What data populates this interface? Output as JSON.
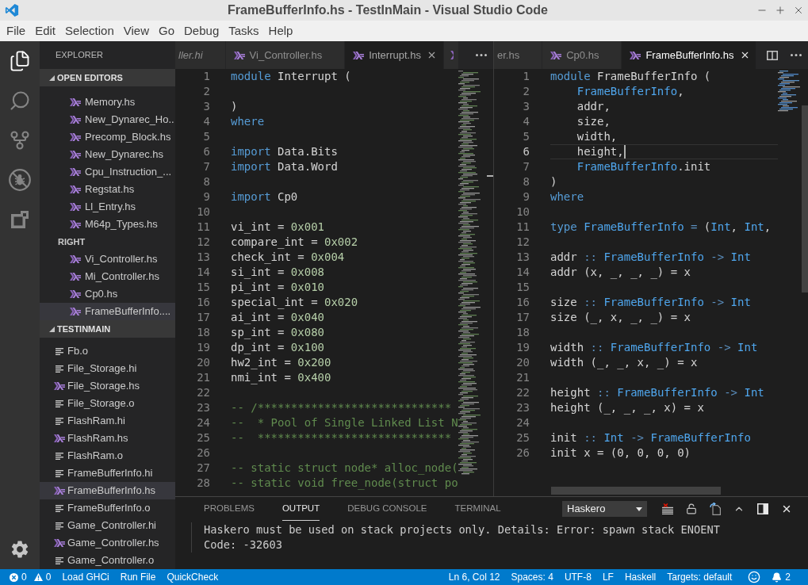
{
  "window": {
    "title": "FrameBufferInfo.hs - TestInMain - Visual Studio Code"
  },
  "menu": [
    "File",
    "Edit",
    "Selection",
    "View",
    "Go",
    "Debug",
    "Tasks",
    "Help"
  ],
  "activity_bar": [
    {
      "selected": true
    },
    {
      "selected": false
    },
    {
      "selected": false
    },
    {
      "selected": false
    },
    {
      "selected": false
    }
  ],
  "sidebar": {
    "title": "EXPLORER",
    "sections": [
      {
        "title": "OPEN EDITORS",
        "expanded": true,
        "groups": [
          {
            "items": [
              {
                "label": "Memory.hs",
                "kind": "haskell",
                "selected": false
              },
              {
                "label": "New_Dynarec_Ho..",
                "kind": "haskell",
                "selected": false
              },
              {
                "label": "Precomp_Block.hs",
                "kind": "haskell",
                "selected": false
              },
              {
                "label": "New_Dynarec.hs",
                "kind": "haskell",
                "selected": false
              },
              {
                "label": "Cpu_Instruction_...",
                "kind": "haskell",
                "selected": false
              },
              {
                "label": "Regstat.hs",
                "kind": "haskell",
                "selected": false
              },
              {
                "label": "Ll_Entry.hs",
                "kind": "haskell",
                "selected": false
              },
              {
                "label": "M64p_Types.hs",
                "kind": "haskell",
                "selected": false
              }
            ]
          },
          {
            "title": "RIGHT",
            "items": [
              {
                "label": "Vi_Controller.hs",
                "kind": "haskell",
                "selected": false
              },
              {
                "label": "Mi_Controller.hs",
                "kind": "haskell",
                "selected": false
              },
              {
                "label": "Cp0.hs",
                "kind": "haskell",
                "selected": false
              },
              {
                "label": "FrameBufferInfo....",
                "kind": "haskell",
                "selected": true
              }
            ]
          }
        ]
      },
      {
        "title": "TESTINMAIN",
        "expanded": true,
        "items": [
          {
            "label": "Fb.o",
            "kind": "text",
            "selected": false
          },
          {
            "label": "File_Storage.hi",
            "kind": "text",
            "selected": false
          },
          {
            "label": "File_Storage.hs",
            "kind": "haskell",
            "selected": false
          },
          {
            "label": "File_Storage.o",
            "kind": "text",
            "selected": false
          },
          {
            "label": "FlashRam.hi",
            "kind": "text",
            "selected": false
          },
          {
            "label": "FlashRam.hs",
            "kind": "haskell",
            "selected": false
          },
          {
            "label": "FlashRam.o",
            "kind": "text",
            "selected": false
          },
          {
            "label": "FrameBufferInfo.hi",
            "kind": "text",
            "selected": false
          },
          {
            "label": "FrameBufferInfo.hs",
            "kind": "haskell",
            "selected": true
          },
          {
            "label": "FrameBufferInfo.o",
            "kind": "text",
            "selected": false
          },
          {
            "label": "Game_Controller.hi",
            "kind": "text",
            "selected": false
          },
          {
            "label": "Game_Controller.hs",
            "kind": "haskell",
            "selected": false
          },
          {
            "label": "Game_Controller.o",
            "kind": "text",
            "selected": false
          }
        ]
      }
    ]
  },
  "editor_groups": [
    {
      "focused": false,
      "tabs": [
        {
          "label": "ller.hi",
          "preview": true,
          "selected": false
        },
        {
          "label": "Vi_Controller.hs",
          "kind": "haskell",
          "preview": false,
          "selected": false
        },
        {
          "label": "Interrupt.hs",
          "kind": "haskell",
          "preview": false,
          "selected": true
        },
        {
          "kind": "haskell",
          "selected": false
        }
      ],
      "lines": [
        {
          "number": "1",
          "code": [
            {
              "kind": "keyword",
              "text": "module"
            },
            {
              "kind": "plain",
              "text": " Interrupt ("
            }
          ]
        },
        {
          "number": "2"
        },
        {
          "number": "3",
          "code": [
            {
              "kind": "plain",
              "text": ")"
            }
          ]
        },
        {
          "number": "4",
          "code": [
            {
              "kind": "keyword",
              "text": "where"
            }
          ]
        },
        {
          "number": "5"
        },
        {
          "number": "6",
          "code": [
            {
              "kind": "keyword",
              "text": "import"
            },
            {
              "kind": "plain",
              "text": " Data.Bits"
            }
          ]
        },
        {
          "number": "7",
          "code": [
            {
              "kind": "keyword",
              "text": "import"
            },
            {
              "kind": "plain",
              "text": " Data.Word"
            }
          ]
        },
        {
          "number": "8"
        },
        {
          "number": "9",
          "code": [
            {
              "kind": "keyword",
              "text": "import"
            },
            {
              "kind": "plain",
              "text": " Cp0"
            }
          ]
        },
        {
          "number": "10"
        },
        {
          "number": "11",
          "code": [
            {
              "kind": "plain",
              "text": "vi_int = "
            },
            {
              "kind": "number",
              "text": "0x001"
            }
          ]
        },
        {
          "number": "12",
          "code": [
            {
              "kind": "plain",
              "text": "compare_int = "
            },
            {
              "kind": "number",
              "text": "0x002"
            }
          ]
        },
        {
          "number": "13",
          "code": [
            {
              "kind": "plain",
              "text": "check_int = "
            },
            {
              "kind": "number",
              "text": "0x004"
            }
          ]
        },
        {
          "number": "14",
          "code": [
            {
              "kind": "plain",
              "text": "si_int = "
            },
            {
              "kind": "number",
              "text": "0x008"
            }
          ]
        },
        {
          "number": "15",
          "code": [
            {
              "kind": "plain",
              "text": "pi_int = "
            },
            {
              "kind": "number",
              "text": "0x010"
            }
          ]
        },
        {
          "number": "16",
          "code": [
            {
              "kind": "plain",
              "text": "special_int = "
            },
            {
              "kind": "number",
              "text": "0x020"
            }
          ]
        },
        {
          "number": "17",
          "code": [
            {
              "kind": "plain",
              "text": "ai_int = "
            },
            {
              "kind": "number",
              "text": "0x040"
            }
          ]
        },
        {
          "number": "18",
          "code": [
            {
              "kind": "plain",
              "text": "sp_int = "
            },
            {
              "kind": "number",
              "text": "0x080"
            }
          ]
        },
        {
          "number": "19",
          "code": [
            {
              "kind": "plain",
              "text": "dp_int = "
            },
            {
              "kind": "number",
              "text": "0x100"
            }
          ]
        },
        {
          "number": "20",
          "code": [
            {
              "kind": "plain",
              "text": "hw2_int = "
            },
            {
              "kind": "number",
              "text": "0x200"
            }
          ]
        },
        {
          "number": "21",
          "code": [
            {
              "kind": "plain",
              "text": "nmi_int = "
            },
            {
              "kind": "number",
              "text": "0x400"
            }
          ]
        },
        {
          "number": "22"
        },
        {
          "number": "23",
          "code": [
            {
              "kind": "comment",
              "text": "-- /*****************************"
            }
          ]
        },
        {
          "number": "24",
          "code": [
            {
              "kind": "comment",
              "text": "--  * Pool of Single Linked List N"
            }
          ]
        },
        {
          "number": "25",
          "code": [
            {
              "kind": "comment",
              "text": "--  *****************************"
            }
          ]
        },
        {
          "number": "26"
        },
        {
          "number": "27",
          "code": [
            {
              "kind": "comment",
              "text": "-- static struct node* alloc_node("
            }
          ]
        },
        {
          "number": "28",
          "code": [
            {
              "kind": "comment",
              "text": "-- static void free_node(struct po"
            }
          ]
        }
      ]
    },
    {
      "focused": true,
      "tabs": [
        {
          "label": "er.hs",
          "preview": false,
          "selected": false
        },
        {
          "label": "Cp0.hs",
          "kind": "haskell",
          "preview": false,
          "selected": false
        },
        {
          "label": "FrameBufferInfo.hs",
          "kind": "haskell",
          "preview": false,
          "selected": true
        }
      ],
      "lines": [
        {
          "number": "1",
          "current": false,
          "code": [
            {
              "kind": "keyword",
              "text": "module"
            },
            {
              "kind": "plain",
              "text": " FrameBufferInfo ("
            }
          ]
        },
        {
          "number": "2",
          "current": false,
          "code": [
            {
              "kind": "type",
              "text": "    FrameBufferInfo"
            },
            {
              "kind": "plain",
              "text": ","
            }
          ]
        },
        {
          "number": "3",
          "current": false,
          "code": [
            {
              "kind": "plain",
              "text": "    addr,"
            }
          ]
        },
        {
          "number": "4",
          "current": false,
          "code": [
            {
              "kind": "plain",
              "text": "    size,"
            }
          ]
        },
        {
          "number": "5",
          "current": false,
          "code": [
            {
              "kind": "plain",
              "text": "    width,"
            }
          ]
        },
        {
          "number": "6",
          "current": true,
          "code": [
            {
              "kind": "plain",
              "text": "    height,"
            }
          ]
        },
        {
          "number": "7",
          "current": false,
          "code": [
            {
              "kind": "type",
              "text": "    FrameBufferInfo"
            },
            {
              "kind": "plain",
              "text": ".init"
            }
          ]
        },
        {
          "number": "8",
          "current": false,
          "code": [
            {
              "kind": "plain",
              "text": ")"
            }
          ]
        },
        {
          "number": "9",
          "current": false,
          "code": [
            {
              "kind": "keyword",
              "text": "where"
            }
          ]
        },
        {
          "number": "10",
          "current": false
        },
        {
          "number": "11",
          "current": false,
          "code": [
            {
              "kind": "keyword",
              "text": "type"
            },
            {
              "kind": "type",
              "text": " FrameBufferInfo"
            },
            {
              "kind": "operator",
              "text": " ="
            },
            {
              "kind": "plain",
              "text": " ("
            },
            {
              "kind": "type",
              "text": "Int"
            },
            {
              "kind": "plain",
              "text": ", "
            },
            {
              "kind": "type",
              "text": "Int"
            },
            {
              "kind": "plain",
              "text": ","
            }
          ]
        },
        {
          "number": "12",
          "current": false
        },
        {
          "number": "13",
          "current": false,
          "code": [
            {
              "kind": "plain",
              "text": "addr "
            },
            {
              "kind": "operator",
              "text": "::"
            },
            {
              "kind": "type",
              "text": " FrameBufferInfo"
            },
            {
              "kind": "operator",
              "text": " ->"
            },
            {
              "kind": "type",
              "text": " Int"
            }
          ]
        },
        {
          "number": "14",
          "current": false,
          "code": [
            {
              "kind": "plain",
              "text": "addr (x, _, _, _) = x"
            }
          ]
        },
        {
          "number": "15",
          "current": false
        },
        {
          "number": "16",
          "current": false,
          "code": [
            {
              "kind": "plain",
              "text": "size "
            },
            {
              "kind": "operator",
              "text": "::"
            },
            {
              "kind": "type",
              "text": " FrameBufferInfo"
            },
            {
              "kind": "operator",
              "text": " ->"
            },
            {
              "kind": "type",
              "text": " Int"
            }
          ]
        },
        {
          "number": "17",
          "current": false,
          "code": [
            {
              "kind": "plain",
              "text": "size (_, x, _, _) = x"
            }
          ]
        },
        {
          "number": "18",
          "current": false
        },
        {
          "number": "19",
          "current": false,
          "code": [
            {
              "kind": "plain",
              "text": "width "
            },
            {
              "kind": "operator",
              "text": "::"
            },
            {
              "kind": "type",
              "text": " FrameBufferInfo"
            },
            {
              "kind": "operator",
              "text": " ->"
            },
            {
              "kind": "type",
              "text": " Int"
            }
          ]
        },
        {
          "number": "20",
          "current": false,
          "code": [
            {
              "kind": "plain",
              "text": "width (_, _, x, _) = x"
            }
          ]
        },
        {
          "number": "21",
          "current": false
        },
        {
          "number": "22",
          "current": false,
          "code": [
            {
              "kind": "plain",
              "text": "height "
            },
            {
              "kind": "operator",
              "text": "::"
            },
            {
              "kind": "type",
              "text": " FrameBufferInfo"
            },
            {
              "kind": "operator",
              "text": " ->"
            },
            {
              "kind": "type",
              "text": " Int"
            }
          ]
        },
        {
          "number": "23",
          "current": false,
          "code": [
            {
              "kind": "plain",
              "text": "height (_, _, _, x) = x"
            }
          ]
        },
        {
          "number": "24",
          "current": false
        },
        {
          "number": "25",
          "current": false,
          "code": [
            {
              "kind": "plain",
              "text": "init "
            },
            {
              "kind": "operator",
              "text": "::"
            },
            {
              "kind": "type",
              "text": " Int"
            },
            {
              "kind": "operator",
              "text": " ->"
            },
            {
              "kind": "type",
              "text": " FrameBufferInfo"
            }
          ]
        },
        {
          "number": "26",
          "current": false,
          "code": [
            {
              "kind": "plain",
              "text": "init x = (0, 0, 0, 0)"
            }
          ]
        }
      ]
    }
  ],
  "panel": {
    "tabs": [
      {
        "label": "PROBLEMS",
        "selected": false
      },
      {
        "label": "OUTPUT",
        "selected": true
      },
      {
        "label": "DEBUG CONSOLE",
        "selected": false
      },
      {
        "label": "TERMINAL",
        "selected": false
      }
    ],
    "channel": "Haskero",
    "output": [
      "Haskero must be used on stack projects only. Details: Error: spawn stack ENOENT",
      "Code: -32603"
    ]
  },
  "status_bar": {
    "errors": "0",
    "warnings": "0",
    "commands": [
      "Load GHCi",
      "Run File",
      "QuickCheck"
    ],
    "info": [
      "Ln 6, Col 12",
      "Spaces: 4",
      "UTF-8",
      "LF",
      "Haskell",
      "Targets: default"
    ],
    "notifications": "2"
  }
}
